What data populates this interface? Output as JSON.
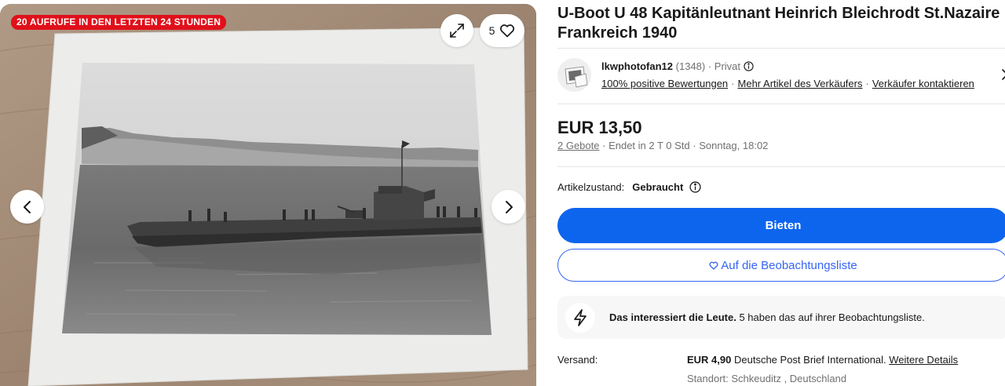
{
  "gallery": {
    "badge": "20 AUFRUFE IN DEN LETZTEN 24 STUNDEN",
    "watch_count": "5",
    "icons": {
      "expand": "expand-icon",
      "heart": "heart-icon",
      "prev": "chevron-left-icon",
      "next": "chevron-right-icon"
    }
  },
  "listing": {
    "title": "U-Boot U 48 Kapitänleutnant Heinrich Bleichrodt St.Nazaire Frankreich 1940"
  },
  "seller": {
    "name": "lkwphotofan12",
    "feedback_count": "(1348)",
    "private_label": "· Privat",
    "positive": "100% positive Bewertungen",
    "more_items": "Mehr Artikel des Verkäufers",
    "contact": "Verkäufer kontaktieren",
    "separator": "·"
  },
  "price": {
    "amount": "EUR 13,50",
    "bids": "2 Gebote",
    "ends": "· Endet in 2 T 0 Std · Sonntag, 18:02"
  },
  "condition": {
    "label": "Artikelzustand:",
    "value": "Gebraucht"
  },
  "actions": {
    "bid_label": "Bieten",
    "watchlist_label": "Auf die Beobachtungsliste"
  },
  "interest": {
    "bold": "Das interessiert die Leute.",
    "text": " 5 haben das auf ihrer Beobachtungsliste."
  },
  "shipping": {
    "label": "Versand:",
    "cost": "EUR 4,90",
    "method": " Deutsche Post Brief International. ",
    "details_link": "Weitere Details",
    "location": "Standort: Schkeuditz , Deutschland"
  },
  "colors": {
    "badge_red": "#e0101a",
    "primary_blue": "#0d65ee",
    "link_blue": "#3665f3"
  }
}
